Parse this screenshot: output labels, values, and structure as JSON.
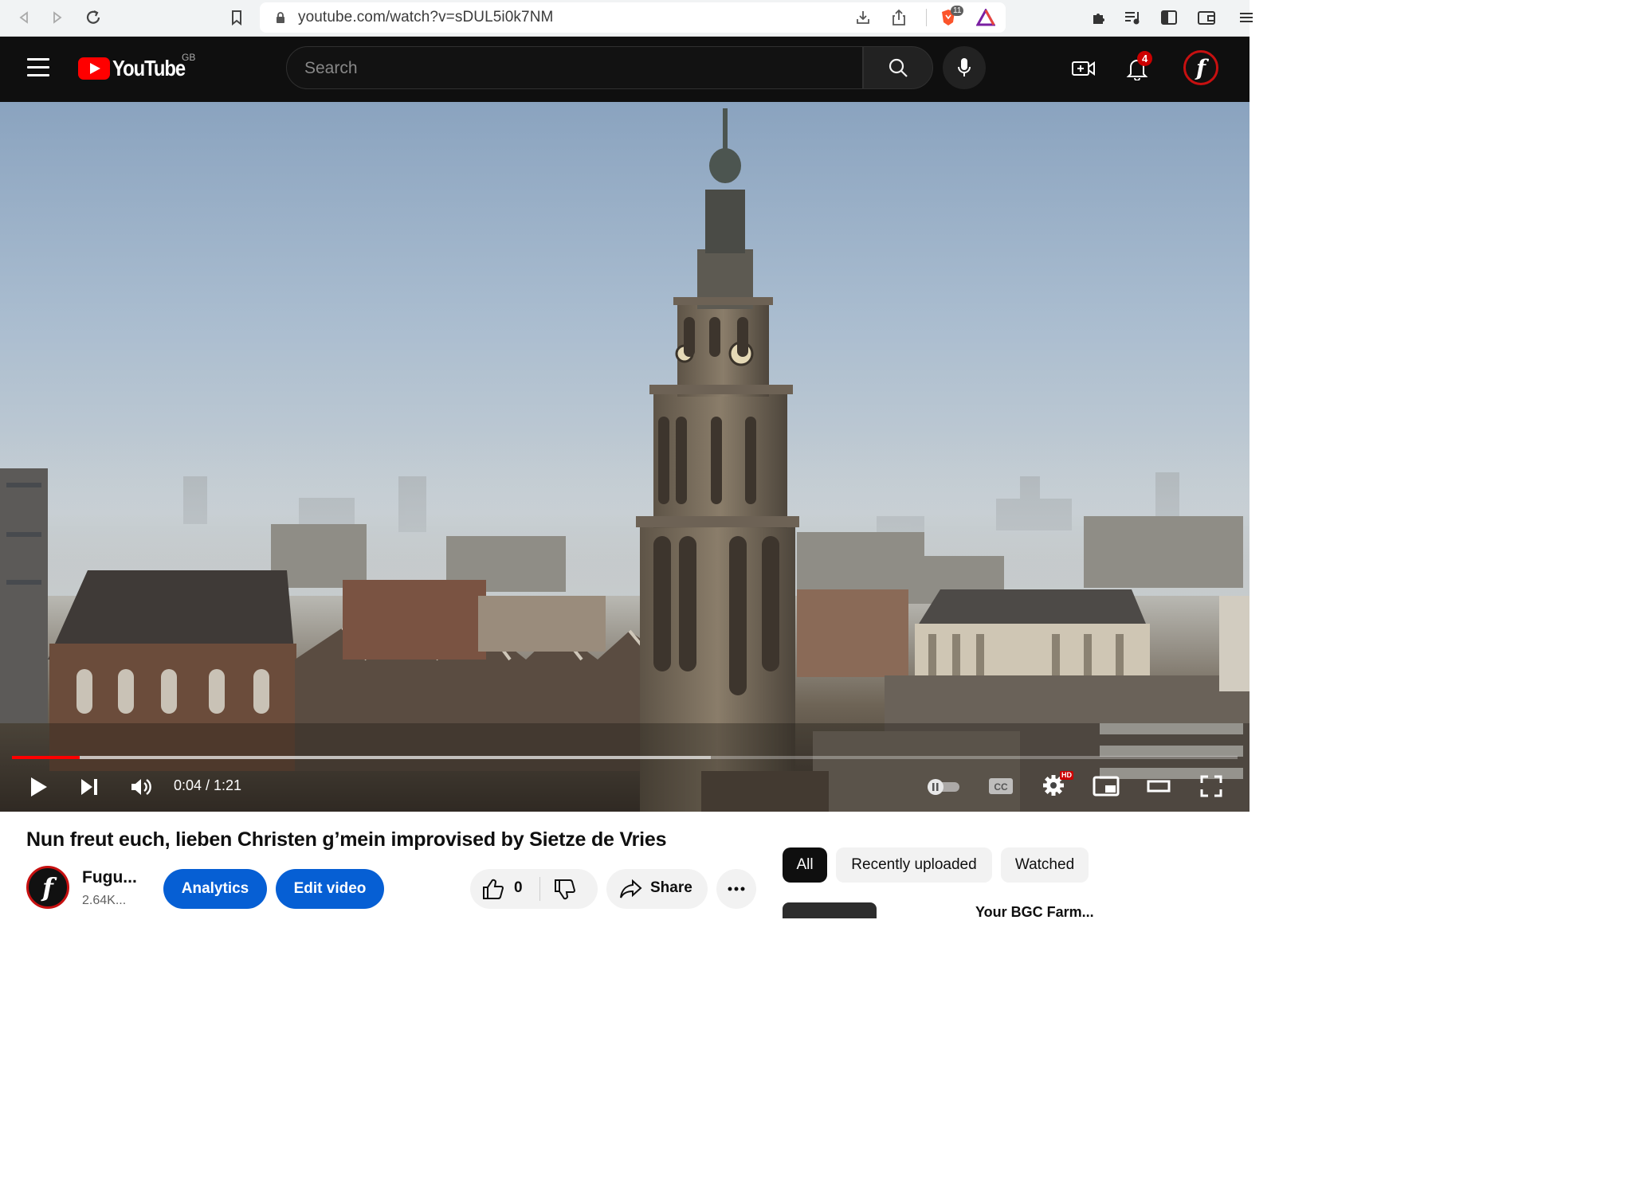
{
  "browser": {
    "url": "youtube.com/watch?v=sDUL5i0k7NM",
    "brave_shield_count": "11"
  },
  "header": {
    "logo_text": "YouTube",
    "region": "GB",
    "search_placeholder": "Search",
    "notification_count": "4",
    "avatar_letter": "f"
  },
  "player": {
    "time_display": "0:04 / 1:21",
    "progress_played_fraction": 0.055,
    "progress_buffered_fraction": 0.57,
    "hd_badge": "HD",
    "cc_label": "CC"
  },
  "video": {
    "title": "Nun freut euch, lieben Christen g’mein improvised by Sietze de Vries"
  },
  "channel": {
    "name": "Fugu...",
    "subscribers": "2.64K...",
    "avatar_letter": "f"
  },
  "actions": {
    "analytics_label": "Analytics",
    "edit_label": "Edit video",
    "like_count": "0",
    "share_label": "Share"
  },
  "sidebar": {
    "chips": [
      "All",
      "Recently uploaded",
      "Watched"
    ],
    "first_item_partial": "Your BGC Farm..."
  },
  "colors": {
    "brand_red": "#ff0000",
    "button_blue": "#065fd4",
    "header_bg": "#0f0f0f"
  }
}
